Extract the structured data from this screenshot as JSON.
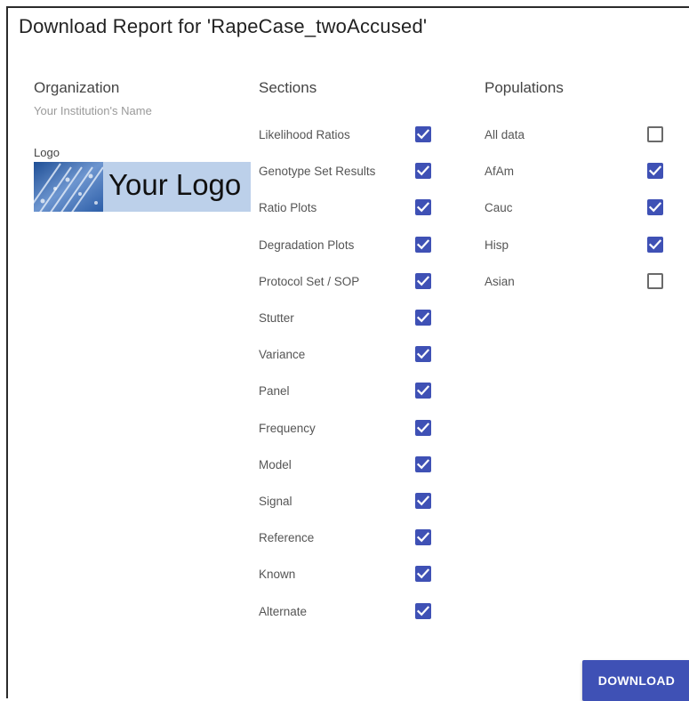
{
  "dialog": {
    "title": "Download Report for 'RapeCase_twoAccused'"
  },
  "organization": {
    "heading": "Organization",
    "placeholder": "Your Institution's Name",
    "logo_label": "Logo",
    "logo_text": "Your Logo"
  },
  "sections": {
    "heading": "Sections",
    "items": [
      {
        "label": "Likelihood Ratios",
        "checked": true
      },
      {
        "label": "Genotype Set Results",
        "checked": true
      },
      {
        "label": "Ratio Plots",
        "checked": true
      },
      {
        "label": "Degradation Plots",
        "checked": true
      },
      {
        "label": "Protocol Set / SOP",
        "checked": true
      },
      {
        "label": "Stutter",
        "checked": true
      },
      {
        "label": "Variance",
        "checked": true
      },
      {
        "label": "Panel",
        "checked": true
      },
      {
        "label": "Frequency",
        "checked": true
      },
      {
        "label": "Model",
        "checked": true
      },
      {
        "label": "Signal",
        "checked": true
      },
      {
        "label": "Reference",
        "checked": true
      },
      {
        "label": "Known",
        "checked": true
      },
      {
        "label": "Alternate",
        "checked": true
      }
    ]
  },
  "populations": {
    "heading": "Populations",
    "items": [
      {
        "label": "All data",
        "checked": false
      },
      {
        "label": "AfAm",
        "checked": true
      },
      {
        "label": "Cauc",
        "checked": true
      },
      {
        "label": "Hisp",
        "checked": true
      },
      {
        "label": "Asian",
        "checked": false
      }
    ]
  },
  "actions": {
    "download_label": "DOWNLOAD"
  },
  "colors": {
    "accent": "#3f51b5",
    "logo_background": "#bcd0ea"
  }
}
